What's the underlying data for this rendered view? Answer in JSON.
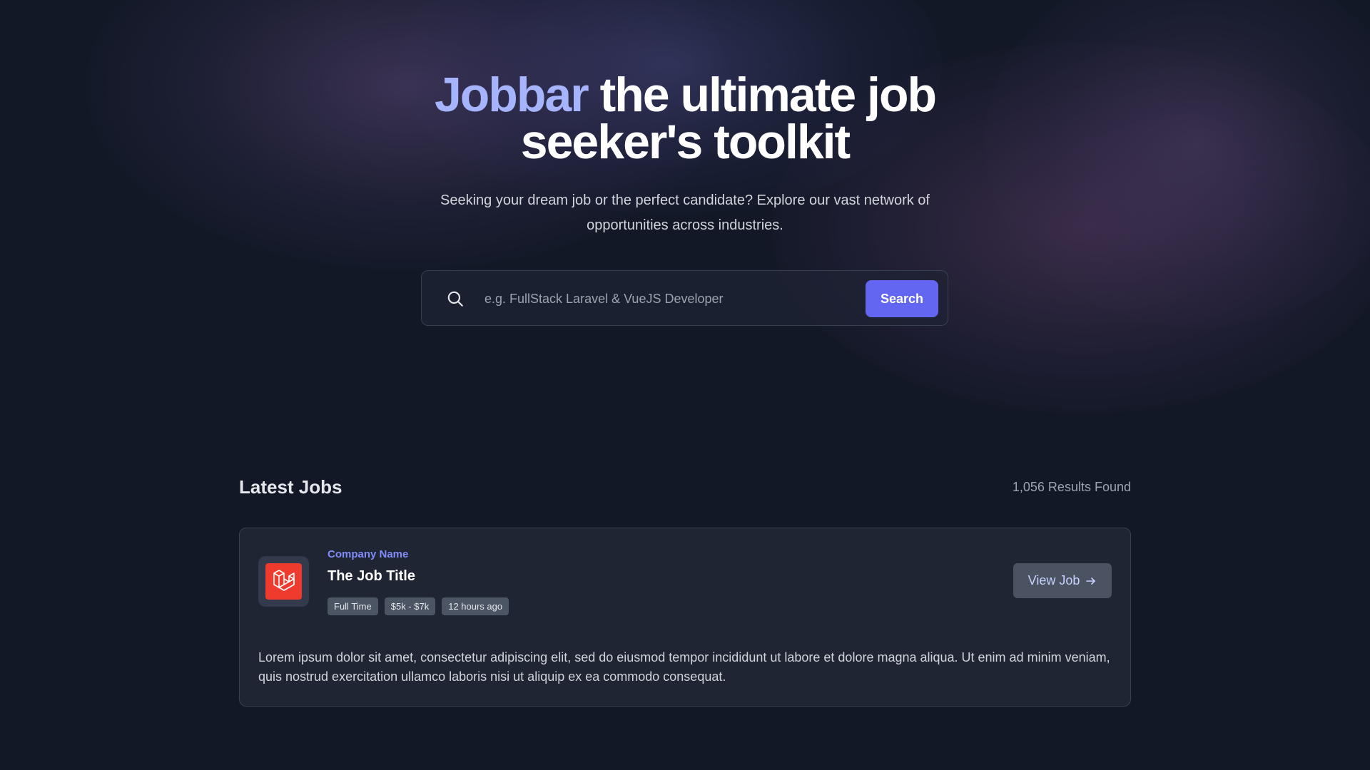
{
  "hero": {
    "title_brand": "Jobbar",
    "title_rest": " the ultimate job seeker's toolkit",
    "subtitle": "Seeking your dream job or the perfect candidate? Explore our vast network of opportunities across industries."
  },
  "search": {
    "icon": "search-icon",
    "placeholder": "e.g. FullStack Laravel & VueJS Developer",
    "value": "",
    "button_label": "Search"
  },
  "jobs": {
    "section_title": "Latest Jobs",
    "results_count": "1,056 Results Found",
    "items": [
      {
        "logo_icon": "laravel-logo-icon",
        "company": "Company Name",
        "title": "The Job Title",
        "tags": [
          "Full Time",
          "$5k - $7k",
          "12 hours ago"
        ],
        "button_label": "View Job",
        "button_icon": "arrow-right-icon",
        "description": "Lorem ipsum dolor sit amet, consectetur adipiscing elit, sed do eiusmod tempor incididunt ut labore et dolore magna aliqua. Ut enim ad minim veniam, quis nostrud exercitation ullamco laboris nisi ut aliquip ex ea commodo consequat."
      }
    ]
  },
  "colors": {
    "accent": "#6366f1",
    "brand_text": "#a5b4fc",
    "company_text": "#818cf8",
    "logo_red": "#ef3b2d",
    "background": "#121826"
  }
}
